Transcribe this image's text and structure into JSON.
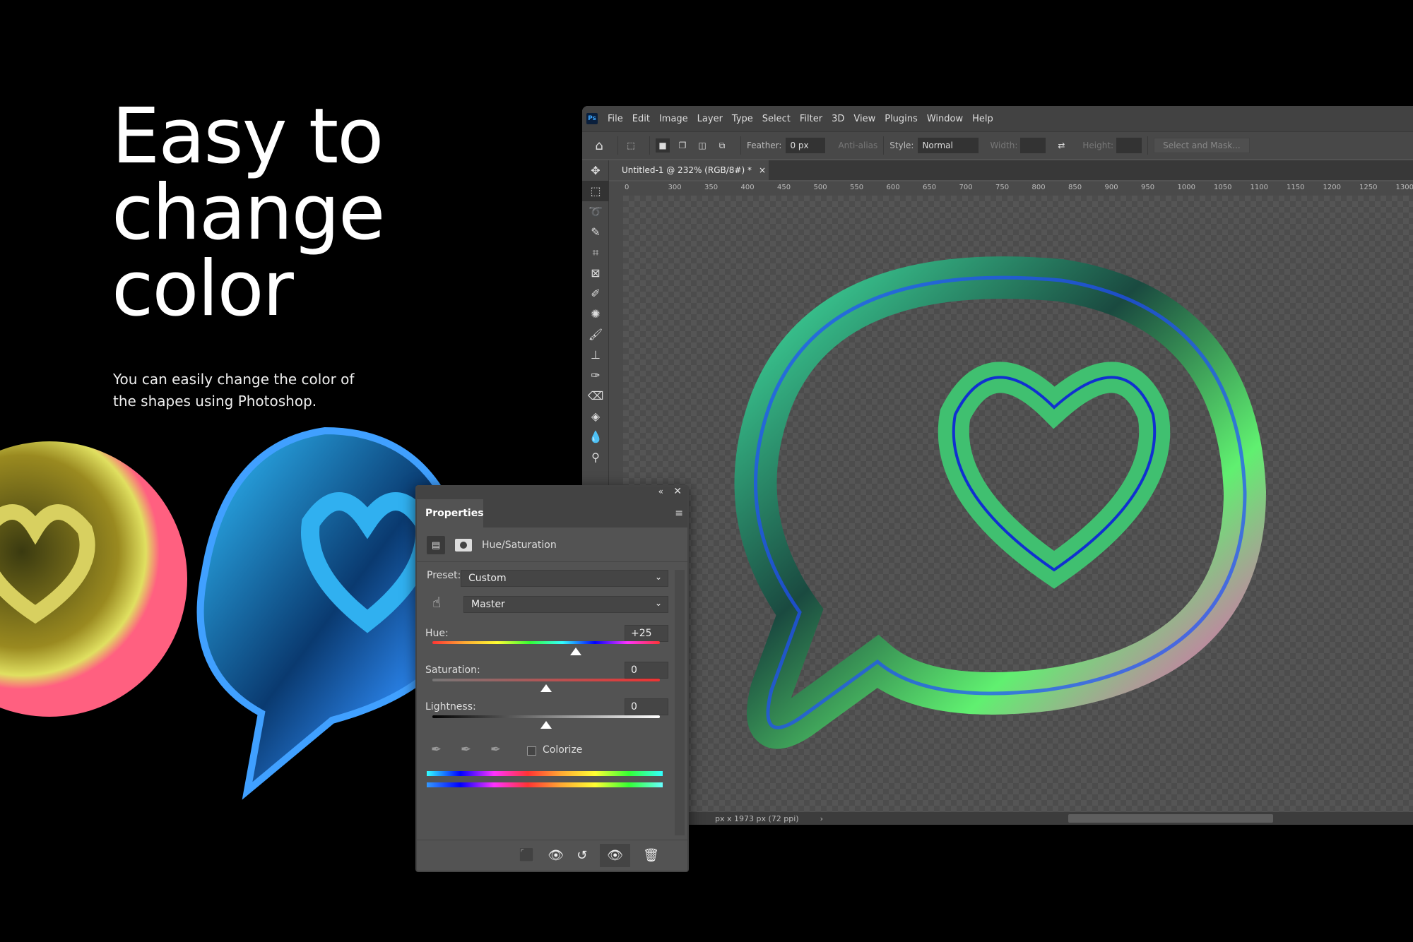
{
  "hero": {
    "headline": [
      "Easy to",
      "change",
      "color"
    ],
    "subtitle": "You can easily change the color of the shapes using Photoshop."
  },
  "photoshop": {
    "logo": "Ps",
    "menu": [
      "File",
      "Edit",
      "Image",
      "Layer",
      "Type",
      "Select",
      "Filter",
      "3D",
      "View",
      "Plugins",
      "Window",
      "Help"
    ],
    "options": {
      "feather_label": "Feather:",
      "feather_value": "0 px",
      "antialias_label": "Anti-alias",
      "style_label": "Style:",
      "style_value": "Normal",
      "width_label": "Width:",
      "height_label": "Height:",
      "select_mask": "Select and Mask..."
    },
    "doc_tab": "Untitled-1 @ 232% (RGB/8#) *",
    "ruler": [
      "0",
      "300",
      "350",
      "400",
      "450",
      "500",
      "550",
      "600",
      "650",
      "700",
      "750",
      "800",
      "850",
      "900",
      "950",
      "1000",
      "1050",
      "1100",
      "1150",
      "1200",
      "1250",
      "1300"
    ],
    "status": "px x 1973 px (72 ppi)"
  },
  "properties": {
    "tab": "Properties",
    "adjustment": "Hue/Saturation",
    "preset_label": "Preset:",
    "preset_value": "Custom",
    "channel_value": "Master",
    "hue_label": "Hue:",
    "hue_value": "+25",
    "hue_level": 25,
    "saturation_label": "Saturation:",
    "saturation_value": "0",
    "lightness_label": "Lightness:",
    "lightness_value": "0",
    "colorize_label": "Colorize",
    "colorize_checked": false
  }
}
